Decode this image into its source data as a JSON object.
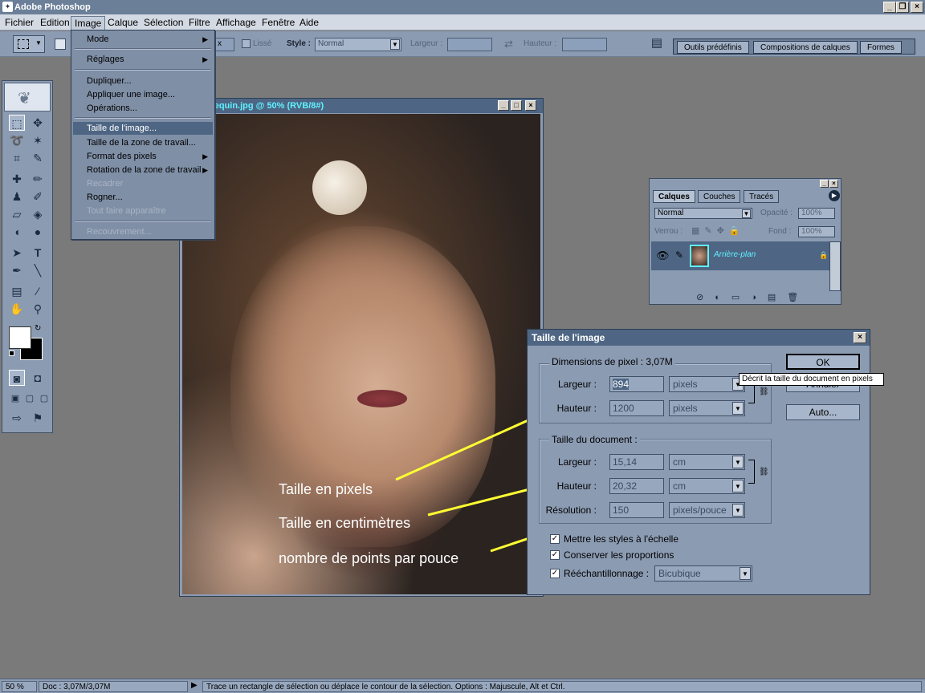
{
  "app": {
    "title": "Adobe Photoshop"
  },
  "menubar": [
    "Fichier",
    "Edition",
    "Image",
    "Calque",
    "Sélection",
    "Filtre",
    "Affichage",
    "Fenêtre",
    "Aide"
  ],
  "options": {
    "x_unit": "x",
    "smooth_label": "Lissé",
    "style_label": "Style :",
    "style_value": "Normal",
    "width_label": "Largeur :",
    "height_label": "Hauteur :"
  },
  "palette_well": {
    "tabs": [
      "Outils prédéfinis",
      "Compositions de calques",
      "Formes"
    ]
  },
  "image_menu": {
    "items": [
      {
        "label": "Mode",
        "submenu": true
      },
      {
        "label": "Réglages",
        "submenu": true
      },
      {
        "label": "Dupliquer..."
      },
      {
        "label": "Appliquer une image..."
      },
      {
        "label": "Opérations..."
      },
      {
        "label": "Taille de l'image...",
        "highlighted": true
      },
      {
        "label": "Taille de la zone de travail..."
      },
      {
        "label": "Format des pixels",
        "submenu": true
      },
      {
        "label": "Rotation de la zone de travail",
        "submenu": true
      },
      {
        "label": "Recadrer",
        "disabled": true
      },
      {
        "label": "Rogner..."
      },
      {
        "label": "Tout faire apparaître",
        "disabled": true
      },
      {
        "label": "Recouvrement...",
        "disabled": true
      }
    ]
  },
  "document": {
    "title": "nequin.jpg @ 50% (RVB/8#)",
    "annotations": [
      "Taille en pixels",
      "Taille en centimètres",
      "nombre de points par pouce"
    ]
  },
  "layers": {
    "tabs": [
      "Calques",
      "Couches",
      "Tracés"
    ],
    "blend_mode": "Normal",
    "opacity_label": "Opacité :",
    "opacity_value": "100%",
    "lock_label": "Verrou :",
    "fill_label": "Fond :",
    "fill_value": "100%",
    "layer_name": "Arrière-plan"
  },
  "dialog": {
    "title": "Taille de l'image",
    "pixel_dims_label": "Dimensions de pixel :  3,07M",
    "px_width_label": "Largeur :",
    "px_width_value": "894",
    "px_width_unit": "pixels",
    "px_height_label": "Hauteur :",
    "px_height_value": "1200",
    "px_height_unit": "pixels",
    "doc_size_label": "Taille du document :",
    "doc_width_label": "Largeur :",
    "doc_width_value": "15,14",
    "doc_width_unit": "cm",
    "doc_height_label": "Hauteur :",
    "doc_height_value": "20,32",
    "doc_height_unit": "cm",
    "resolution_label": "Résolution :",
    "resolution_value": "150",
    "resolution_unit": "pixels/pouce",
    "ok_label": "OK",
    "cancel_label": "Annuler",
    "auto_label": "Auto...",
    "scale_styles_label": "Mettre les styles à l'échelle",
    "constrain_label": "Conserver les proportions",
    "resample_label": "Rééchantillonnage :",
    "resample_value": "Bicubique",
    "tooltip": "Décrit la taille du document en pixels"
  },
  "statusbar": {
    "zoom": "50 %",
    "doc": "Doc : 3,07M/3,07M",
    "hint": "Trace un rectangle de sélection ou déplace le contour de la sélection. Options : Majuscule, Alt et Ctrl."
  }
}
